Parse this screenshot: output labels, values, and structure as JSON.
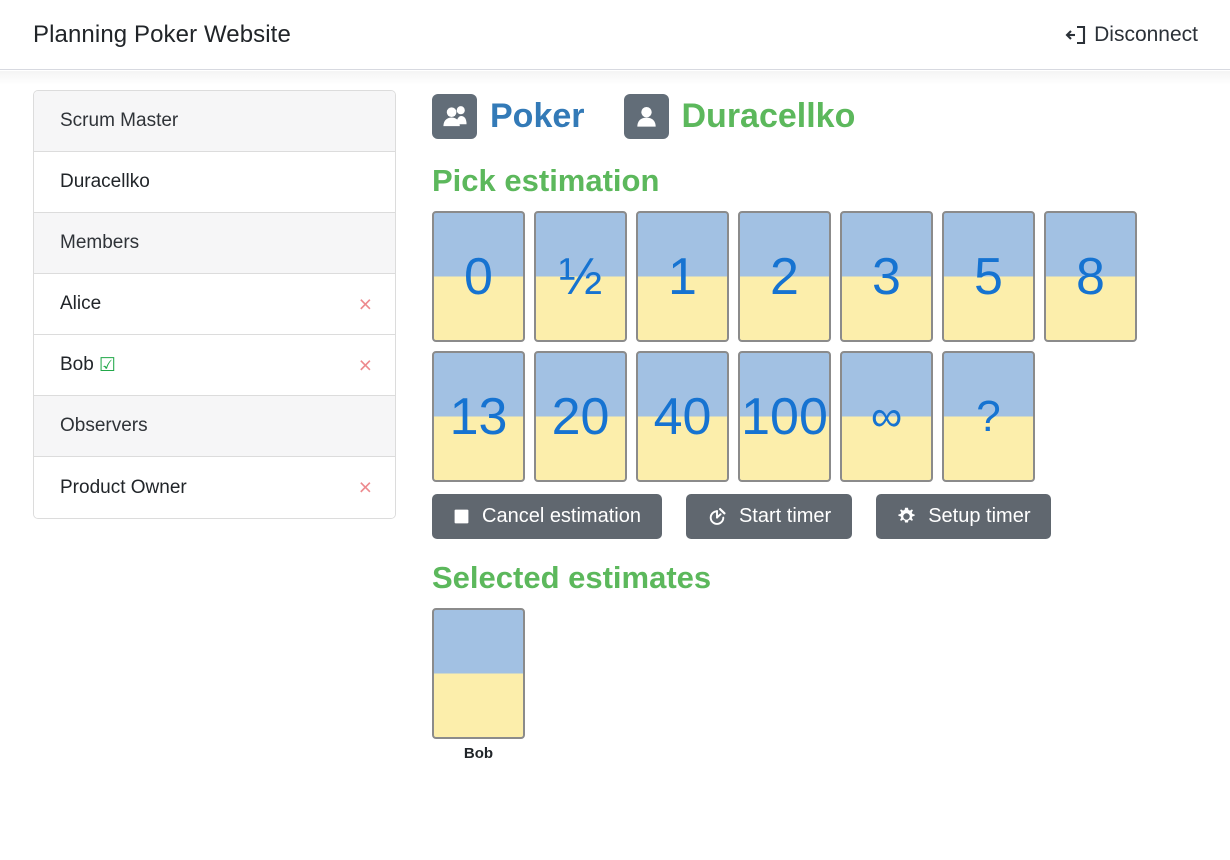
{
  "header": {
    "title": "Planning Poker Website",
    "disconnect_label": "Disconnect",
    "disconnect_icon": "sign-out-icon"
  },
  "sidebar": {
    "rows": [
      {
        "label": "Scrum Master",
        "type": "header",
        "removable": false,
        "voted": false
      },
      {
        "label": "Duracellko",
        "type": "member",
        "removable": false,
        "voted": false
      },
      {
        "label": "Members",
        "type": "header",
        "removable": false,
        "voted": false
      },
      {
        "label": "Alice",
        "type": "member",
        "removable": true,
        "voted": false
      },
      {
        "label": "Bob",
        "type": "member",
        "removable": true,
        "voted": true
      },
      {
        "label": "Observers",
        "type": "header",
        "removable": false,
        "voted": false
      },
      {
        "label": "Product Owner",
        "type": "member",
        "removable": true,
        "voted": false
      }
    ],
    "remove_glyph": "×",
    "voted_glyph": "☑",
    "remove_icon": "remove-member-icon",
    "voted_icon": "voted-check-icon"
  },
  "main": {
    "team_icon": "users-group-icon",
    "team_name": "Poker",
    "user_icon": "user-icon",
    "user_name": "Duracellko",
    "pick_estimation_heading": "Pick estimation",
    "selected_estimates_heading": "Selected estimates",
    "cards": [
      [
        {
          "value": "0",
          "size": "normal"
        },
        {
          "value": "½",
          "size": "normal"
        },
        {
          "value": "1",
          "size": "normal"
        },
        {
          "value": "2",
          "size": "normal"
        },
        {
          "value": "3",
          "size": "normal"
        },
        {
          "value": "5",
          "size": "normal"
        },
        {
          "value": "8",
          "size": "normal"
        }
      ],
      [
        {
          "value": "13",
          "size": "normal"
        },
        {
          "value": "20",
          "size": "normal"
        },
        {
          "value": "40",
          "size": "normal"
        },
        {
          "value": "100",
          "size": "normal"
        },
        {
          "value": "∞",
          "size": "small"
        },
        {
          "value": "?",
          "size": "small"
        }
      ]
    ],
    "buttons": [
      {
        "label": "Cancel estimation",
        "icon": "stop-square-icon"
      },
      {
        "label": "Start timer",
        "icon": "stopwatch-icon"
      },
      {
        "label": "Setup timer",
        "icon": "gear-icon"
      }
    ],
    "selected_estimates": [
      {
        "name": "Bob",
        "value": ""
      }
    ]
  },
  "colors": {
    "card_top": "#a2c1e3",
    "card_bottom": "#fceeab",
    "card_border": "#8b8b8b",
    "card_text": "#1673d1",
    "heading_green": "#5cb85c",
    "team_blue": "#337ab7",
    "button_gray": "#60676f",
    "badge_gray": "#626d78",
    "remove_red": "#ed8a8e",
    "voted_green": "#22a84a"
  }
}
